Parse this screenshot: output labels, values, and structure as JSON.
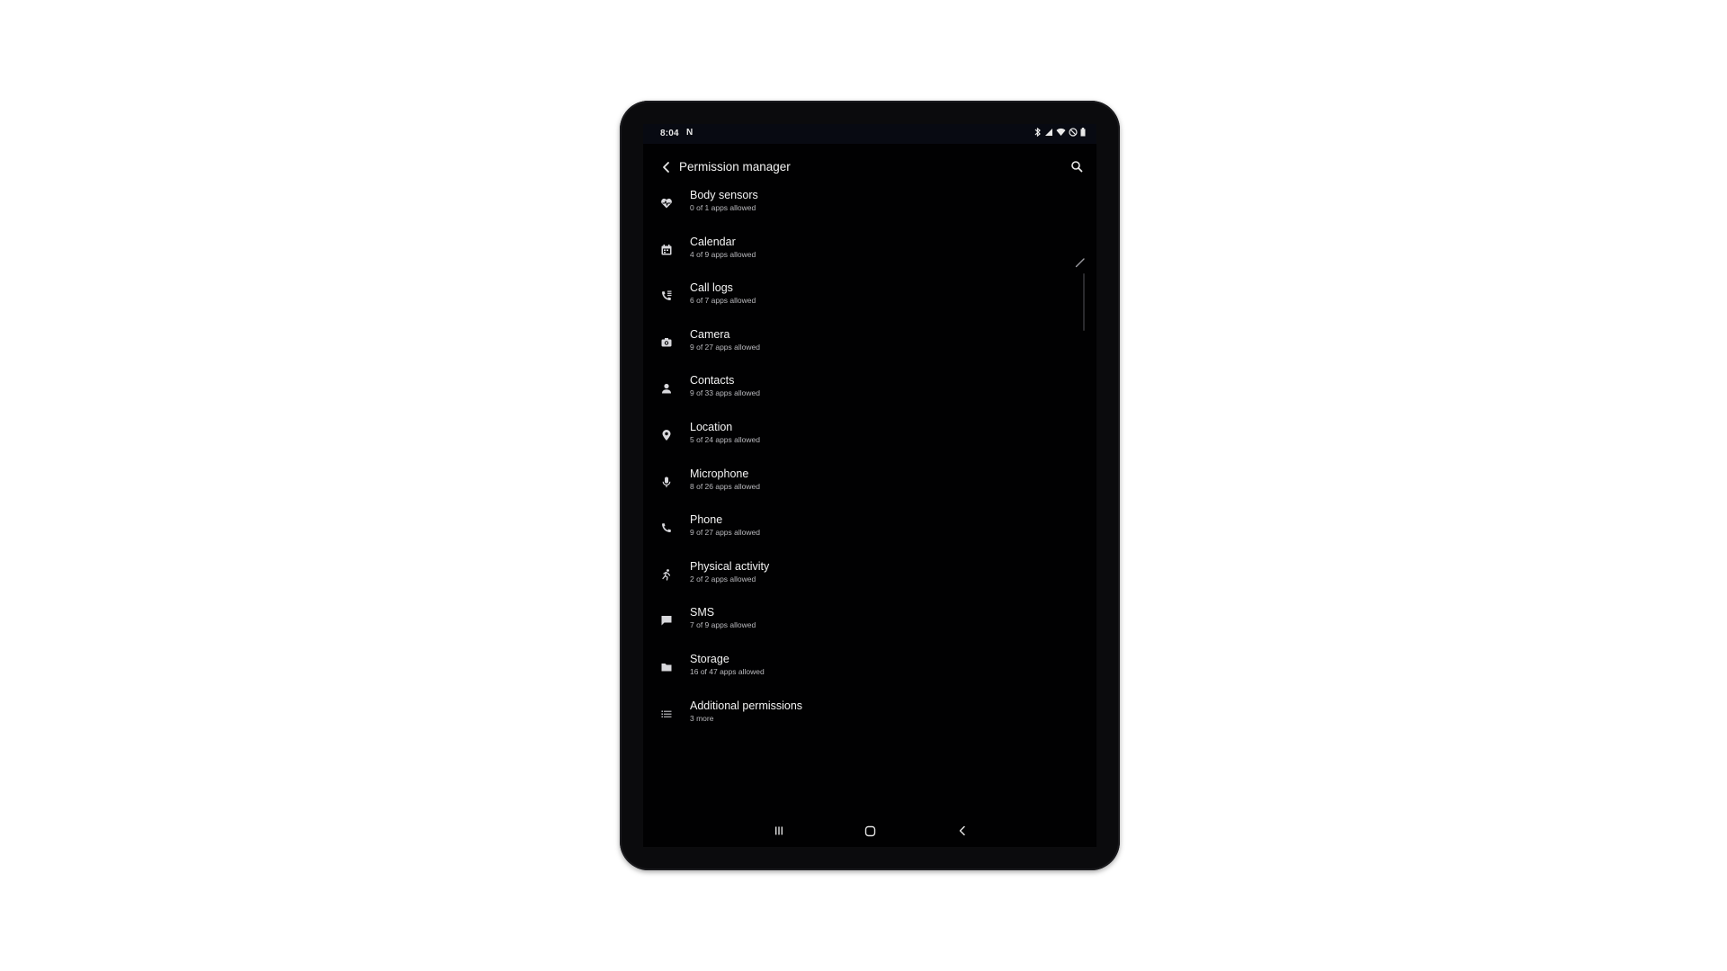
{
  "status_bar": {
    "time": "8:04",
    "notification": "N",
    "icons": [
      "bluetooth-icon",
      "signal-icon",
      "wifi-icon",
      "dnd-icon",
      "battery-icon"
    ]
  },
  "app_bar": {
    "title": "Permission manager",
    "back_icon": "back-arrow-icon",
    "search_icon": "search-icon"
  },
  "permissions": [
    {
      "name": "Body sensors",
      "summary": "0 of 1 apps allowed",
      "icon": "heart-pulse-icon"
    },
    {
      "name": "Calendar",
      "summary": "4 of 9 apps allowed",
      "icon": "calendar-icon"
    },
    {
      "name": "Call logs",
      "summary": "6 of 7 apps allowed",
      "icon": "call-log-icon"
    },
    {
      "name": "Camera",
      "summary": "9 of 27 apps allowed",
      "icon": "camera-icon"
    },
    {
      "name": "Contacts",
      "summary": "9 of 33 apps allowed",
      "icon": "person-icon"
    },
    {
      "name": "Location",
      "summary": "5 of 24 apps allowed",
      "icon": "location-pin-icon"
    },
    {
      "name": "Microphone",
      "summary": "8 of 26 apps allowed",
      "icon": "microphone-icon"
    },
    {
      "name": "Phone",
      "summary": "9 of 27 apps allowed",
      "icon": "phone-icon"
    },
    {
      "name": "Physical activity",
      "summary": "2 of 2 apps allowed",
      "icon": "running-icon"
    },
    {
      "name": "SMS",
      "summary": "7 of 9 apps allowed",
      "icon": "chat-bubble-icon"
    },
    {
      "name": "Storage",
      "summary": "16 of 47 apps allowed",
      "icon": "folder-icon"
    },
    {
      "name": "Additional permissions",
      "summary": "3 more",
      "icon": "list-icon"
    }
  ],
  "nav_bar": {
    "recents_icon": "recents-icon",
    "home_icon": "home-icon",
    "back_icon": "back-icon"
  },
  "colors": {
    "screen_background": "#010102",
    "status_bar_background": "#080a12",
    "text_primary": "#f4f4f4",
    "text_secondary": "#b9b9bd",
    "icon": "#d8d8dc",
    "device_frame": "#0b0b0d"
  }
}
